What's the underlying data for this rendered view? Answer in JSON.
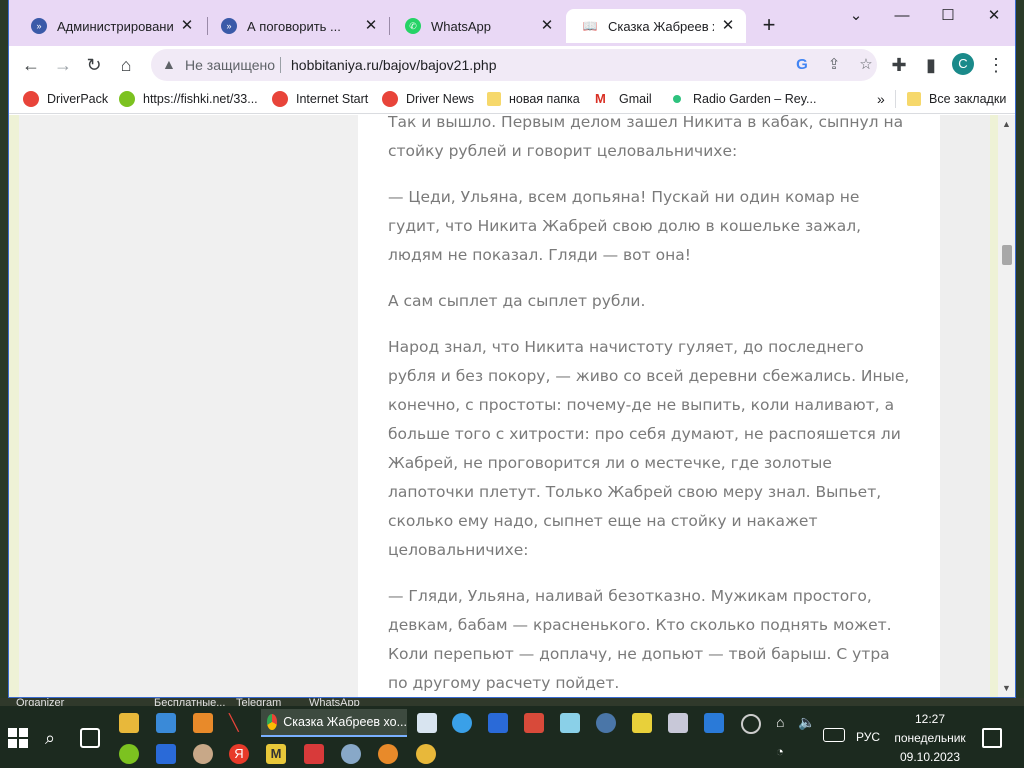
{
  "tabs": [
    {
      "title": "Администрирование",
      "icon": "admin-tab-icon",
      "active": false
    },
    {
      "title": "А поговорить ...",
      "icon": "admin-tab-icon",
      "active": false
    },
    {
      "title": "WhatsApp",
      "icon": "whatsapp-icon",
      "active": false
    },
    {
      "title": "Сказка Жабреев ход",
      "icon": "book-icon",
      "active": true
    }
  ],
  "toolbar": {
    "security_label": "Не защищено",
    "url": "hobbitaniya.ru/bajov/bajov21.php",
    "profile_letter": "C"
  },
  "bookmarks": [
    {
      "label": "DriverPack",
      "color": "#e8443a"
    },
    {
      "label": "https://fishki.net/33...",
      "color": "#7cc220"
    },
    {
      "label": "Internet Start",
      "color": "#e8443a"
    },
    {
      "label": "Driver News",
      "color": "#e8443a"
    },
    {
      "label": "новая папка",
      "color": "#f6d86b"
    },
    {
      "label": "Gmail",
      "color": "#d93025"
    },
    {
      "label": "Radio Garden – Rey...",
      "color": "#2ec27e"
    }
  ],
  "bookmarks_all": "Все закладки",
  "article": {
    "paragraphs": [
      "Так и вышло. Первым делом зашел Никита в кабак, сыпнул на стойку рублей и говорит целовальничихе:",
      "— Цеди, Ульяна, всем допьяна! Пускай ни один комар не гудит, что Никита Жабрей свою долю в кошельке зажал, людям не показал. Гляди — вот она!",
      "А сам сыплет да сыплет рубли.",
      "Народ знал, что Никита начистоту гуляет, до последнего рубля и без покору, — живо со всей деревни сбежались. Иные, конечно, с простоты: почему-де не выпить, коли наливают, а больше того с хитрости: про себя думают, не распояшется ли Жабрей, не проговорится ли о местечке, где золотые лапоточки плетут. Только Жабрей свою меру знал. Выпьет, сколько ему надо, сыпнет еще на стойку и накажет целовальничихе:",
      "— Гляди, Ульяна, наливай безотказно. Мужикам простого, девкам, бабам — красненького. Кто сколько поднять может. Коли перепьют — доплачу, не допьют — твой барыш. С утра по другому расчету пойдет."
    ]
  },
  "desktop_labels": [
    "Organizer",
    "Бесплатные...",
    "Telegram",
    "WhatsApp"
  ],
  "taskbar": {
    "active_window": "Сказка Жабреев хо...",
    "language": "РУС",
    "time": "12:27",
    "weekday": "понедельник",
    "date": "09.10.2023"
  }
}
